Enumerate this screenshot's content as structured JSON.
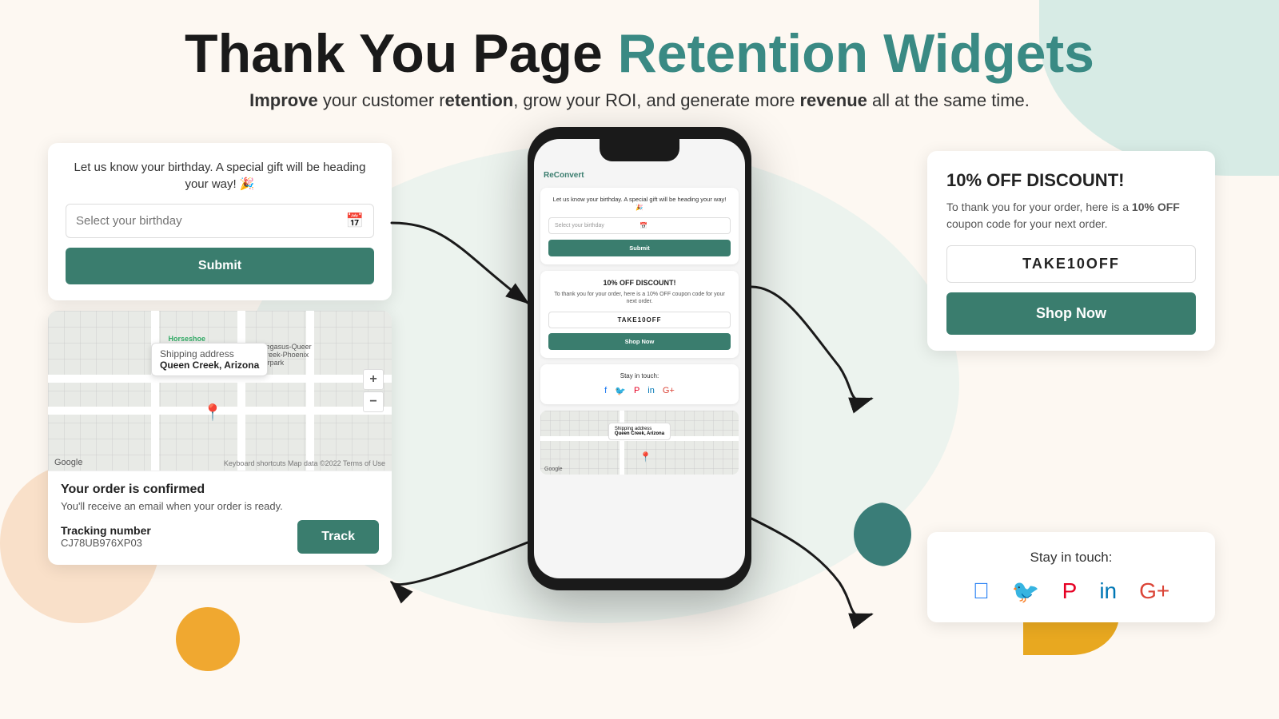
{
  "header": {
    "title_black": "Thank You Page",
    "title_green": "Retention Widgets",
    "subtitle_prefix": "Improve",
    "subtitle_mid1": " your customer r",
    "subtitle_bold1": "etention",
    "subtitle_mid2": ", grow your ROI, and generate more ",
    "subtitle_bold2": "revenue",
    "subtitle_end": " all at the same time."
  },
  "birthday_widget": {
    "message": "Let us know your birthday. A special gift will be heading your way! 🎉",
    "input_placeholder": "Select your birthday",
    "submit_label": "Submit"
  },
  "map_widget": {
    "popup_label": "Shipping address",
    "popup_value": "Queen Creek, Arizona",
    "labels": [
      "Horseshoe Park & Equestrian",
      "Pegasus-Queer Creek-Phoenix Airpark"
    ],
    "zoom_plus": "+",
    "zoom_minus": "−",
    "google_text": "Google",
    "map_footer": "Keyboard shortcuts  Map data ©2022  Terms of Use"
  },
  "order_widget": {
    "confirmed": "Your order is confirmed",
    "email_note": "You'll receive an email when your order is ready.",
    "tracking_label": "Tracking number",
    "tracking_number": "CJ78UB976XP03",
    "track_button": "Track"
  },
  "discount_widget": {
    "title": "10% OFF DISCOUNT!",
    "desc_prefix": "To thank you for your order, here is a ",
    "desc_bold": "10% OFF",
    "desc_suffix": " coupon code for your next order.",
    "code": "TAKE10OFF",
    "shop_label": "Shop Now"
  },
  "social_widget": {
    "title": "Stay in touch:"
  },
  "phone": {
    "logo": "ReConvert",
    "birthday_msg": "Let us know your birthday. A special gift will be heading your way! 🎉",
    "birthday_placeholder": "Select your birthday",
    "submit": "Submit",
    "discount_title": "10% OFF DISCOUNT!",
    "discount_desc": "To thank you for your order, here is a 10% OFF coupon code for your next order.",
    "discount_code": "TAKE10OFF",
    "discount_btn": "Shop Now",
    "social_title": "Stay in touch:",
    "map_popup_label": "Shipping address",
    "map_popup_value": "Queen Creek, Arizona"
  }
}
